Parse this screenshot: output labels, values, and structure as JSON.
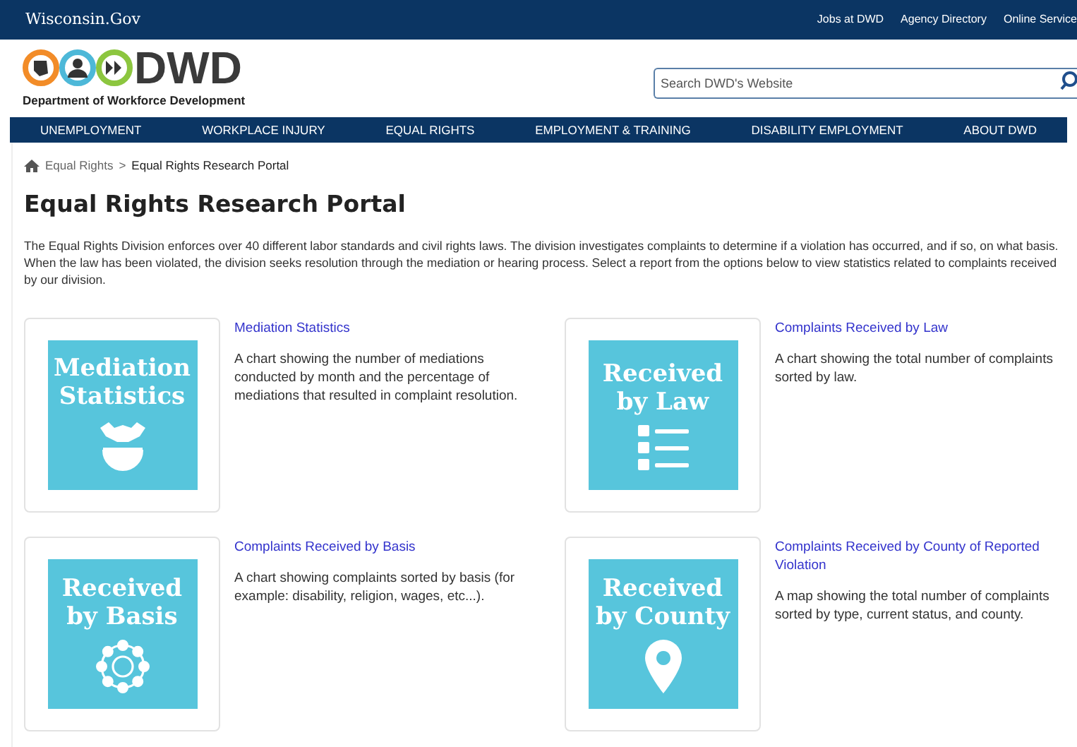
{
  "top_bar": {
    "brand": "Wisconsin.Gov",
    "links": [
      "Jobs at DWD",
      "Agency Directory",
      "Online Service"
    ]
  },
  "header": {
    "logo_text": "DWD",
    "logo_subtitle": "Department of Workforce Development",
    "search": {
      "placeholder": "Search DWD's Website"
    }
  },
  "nav": [
    "UNEMPLOYMENT",
    "WORKPLACE INJURY",
    "EQUAL RIGHTS",
    "EMPLOYMENT & TRAINING",
    "DISABILITY EMPLOYMENT",
    "ABOUT DWD"
  ],
  "breadcrumb": {
    "parent": "Equal Rights",
    "separator": ">",
    "current": "Equal Rights Research Portal"
  },
  "title": "Equal Rights Research Portal",
  "intro": "The Equal Rights Division enforces over 40 different labor standards and civil rights laws. The division investigates complaints to determine if a violation has occurred, and if so, on what basis. When the law has been violated, the division seeks resolution through the mediation or hearing process. Select a report from the options below to view statistics related to complaints received by our division.",
  "reports": [
    {
      "tile": [
        "Mediation",
        "Statistics"
      ],
      "kind": "handshake",
      "link": "Mediation Statistics",
      "description": "A chart showing the number of mediations conducted by month and the percentage of mediations that resulted in complaint resolution."
    },
    {
      "tile": [
        "Received",
        "by Law"
      ],
      "kind": "list",
      "link": "Complaints Received by Law",
      "description": "A chart showing the total number of complaints sorted by law."
    },
    {
      "tile": [
        "Received",
        "by Basis"
      ],
      "kind": "network",
      "link": "Complaints Received by Basis",
      "description": "A chart showing complaints sorted by basis (for example: disability, religion, wages, etc...)."
    },
    {
      "tile": [
        "Received",
        "by County"
      ],
      "kind": "pin",
      "link": "Complaints Received by County of Reported Violation",
      "description": "A map showing the total number of complaints sorted by type, current status, and county."
    }
  ]
}
